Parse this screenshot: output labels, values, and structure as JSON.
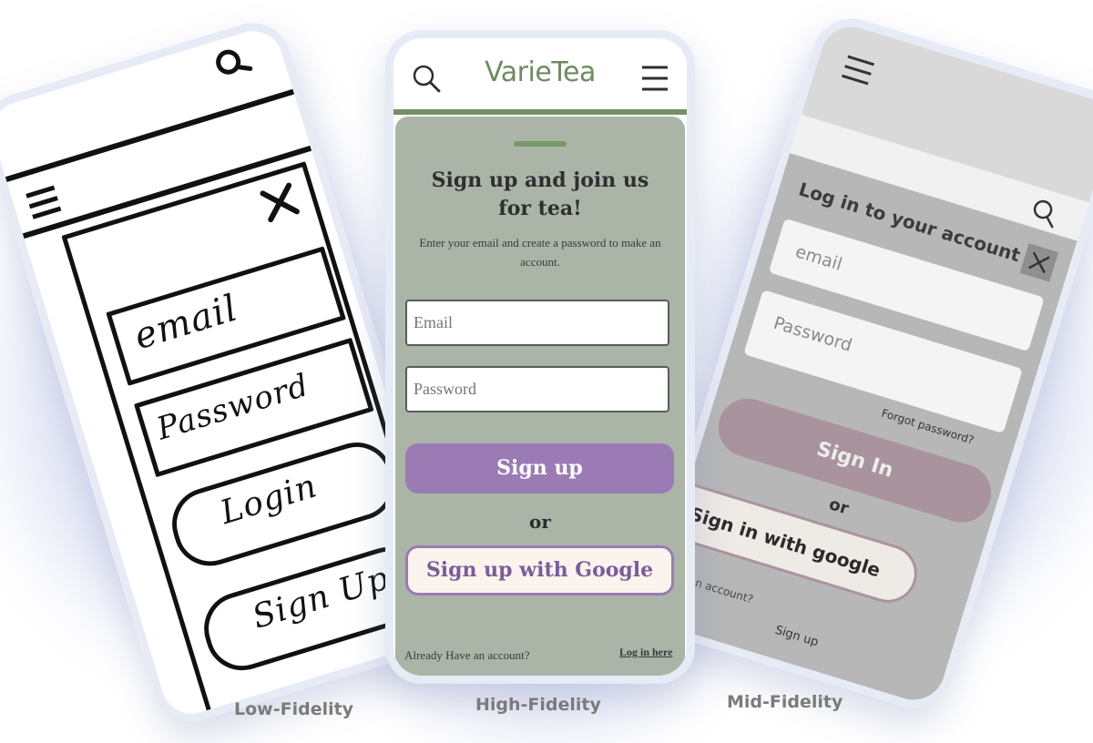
{
  "captions": {
    "low": "Low-Fidelity",
    "high": "High-Fidelity",
    "mid": "Mid-Fidelity"
  },
  "low_fidelity": {
    "email_field": "email",
    "password_field": "Password",
    "login_button": "Login",
    "signup_button": "Sign Up",
    "icons": [
      "search-icon",
      "menu-icon",
      "close-icon"
    ]
  },
  "high_fidelity": {
    "brand": "VarieTea",
    "title": "Sign up and join us for tea!",
    "subtitle": "Enter your email and create a password to make an account.",
    "email_placeholder": "Email",
    "password_placeholder": "Password",
    "signup_button": "Sign up",
    "or_text": "or",
    "google_button": "Sign up with Google",
    "footer_prompt": "Already Have an account?",
    "login_link": "Log in here",
    "colors": {
      "brand": "#6f8b62",
      "card": "#aab5a8",
      "primary_button": "#9b7bb4",
      "google_button_bg": "#fbf3ee",
      "google_button_border": "#9b7bb4"
    },
    "icons": [
      "search-icon",
      "menu-icon"
    ]
  },
  "mid_fidelity": {
    "title": "Log in to your account",
    "email_placeholder": "email",
    "password_placeholder": "Password",
    "forgot_password": "Forgot password?",
    "signin_button": "Sign In",
    "or_text": "or",
    "google_button": "Sign in with google",
    "footer_prompt": "ave an account?",
    "signup_link": "Sign up",
    "icons": [
      "menu-icon",
      "search-icon",
      "close-icon"
    ]
  }
}
